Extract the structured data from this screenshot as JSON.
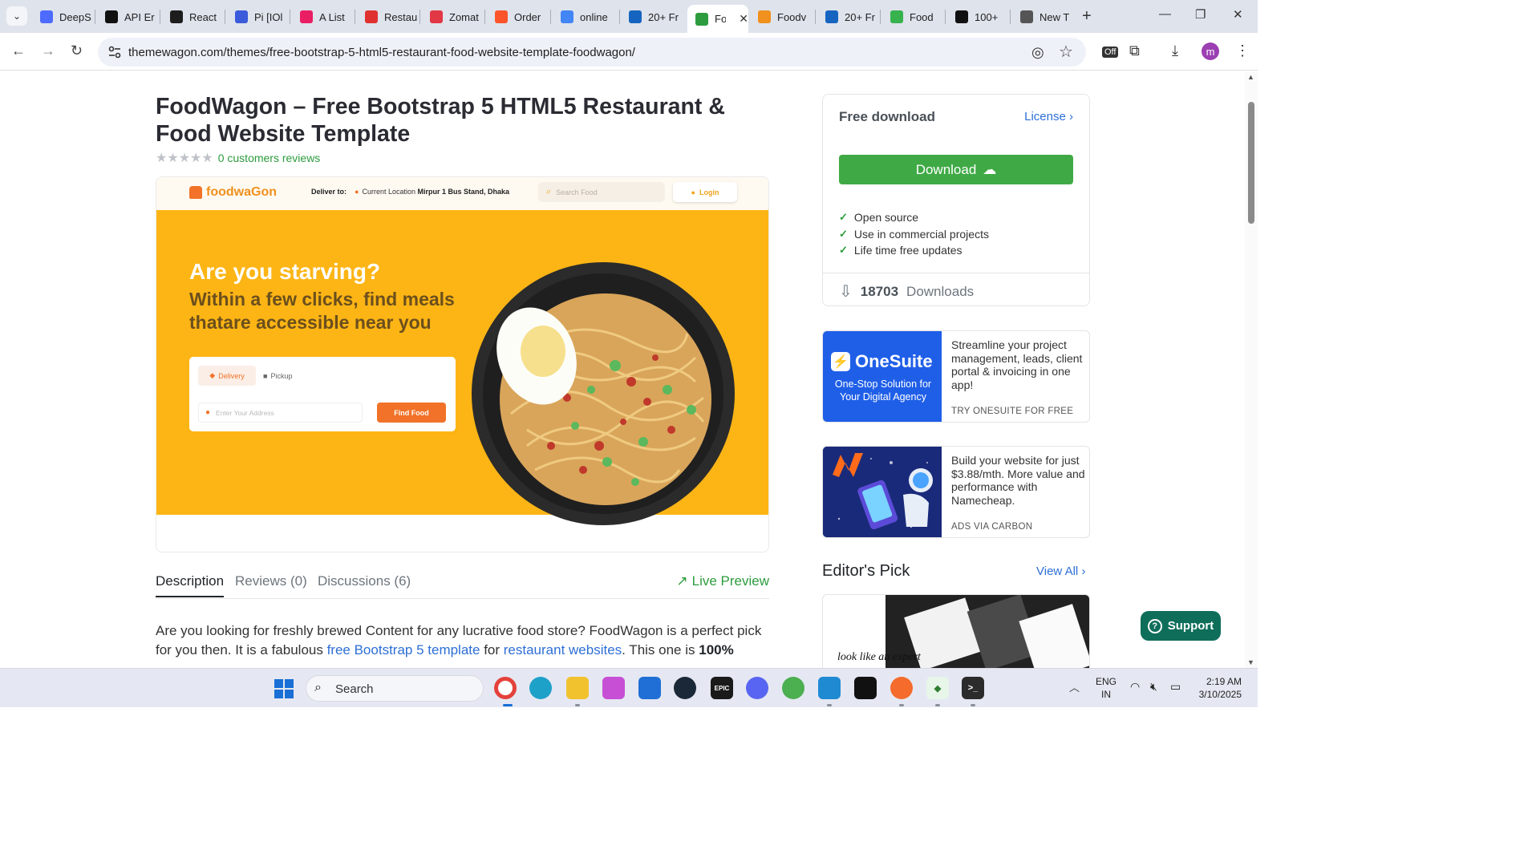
{
  "browser": {
    "tabs": [
      {
        "title": "DeepS",
        "icon": "deepseek-icon",
        "color": "#4d6bfe"
      },
      {
        "title": "API Er",
        "icon": "openai-icon",
        "color": "#111111"
      },
      {
        "title": "React",
        "icon": "react-icon",
        "color": "#1d1d1d"
      },
      {
        "title": "Pi [IOl",
        "icon": "pi-icon",
        "color": "#3b5bdb"
      },
      {
        "title": "A List",
        "icon": "list-icon",
        "color": "#e91e63"
      },
      {
        "title": "Restau",
        "icon": "restaurant-icon",
        "color": "#e03131"
      },
      {
        "title": "Zomat",
        "icon": "zomato-icon",
        "color": "#e23744"
      },
      {
        "title": "Order",
        "icon": "brave-icon",
        "color": "#fb542b"
      },
      {
        "title": "online",
        "icon": "google-icon",
        "color": "#4285f4"
      },
      {
        "title": "20+ Fr",
        "icon": "te-icon",
        "color": "#1565c0"
      },
      {
        "title": "Fo",
        "icon": "themewagon-icon",
        "color": "#2d9c3e",
        "active": true
      },
      {
        "title": "Foodv",
        "icon": "foodwagon-icon",
        "color": "#f0901d"
      },
      {
        "title": "20+ Fr",
        "icon": "te-icon",
        "color": "#1565c0"
      },
      {
        "title": "Food",
        "icon": "food-icon",
        "color": "#37b24d"
      },
      {
        "title": "100+",
        "icon": "unsplash-icon",
        "color": "#111111"
      },
      {
        "title": "New T",
        "icon": "chrome-icon",
        "color": "#555555"
      }
    ],
    "url": "themewagon.com/themes/free-bootstrap-5-html5-restaurant-food-website-template-foodwagon/"
  },
  "page": {
    "title": "FoodWagon – Free Bootstrap 5 HTML5 Restaurant & Food Website Template",
    "stars": "★★★★★",
    "reviews_link": "0 customers reviews",
    "preview": {
      "logo": "foodwaGon",
      "deliver_label": "Deliver to:",
      "location_label": "Current Location",
      "location_value": "Mirpur 1 Bus Stand, Dhaka",
      "search_placeholder": "Search Food",
      "login": "Login",
      "headline": "Are you starving?",
      "subheadline": "Within a few clicks, find meals thatare accessible near you",
      "tab_delivery": "Delivery",
      "tab_pickup": "Pickup",
      "address_placeholder": "Enter Your Address",
      "find_button": "Find Food"
    },
    "tabs": {
      "description": "Description",
      "reviews": "Reviews (0)",
      "discussions": "Discussions (6)",
      "live_preview": "Live Preview"
    },
    "description": {
      "line1": "Are you looking for freshly brewed Content for any lucrative food store? FoodWagon is a perfect pick for you then. It is a fabulous ",
      "link1": "free Bootstrap 5 template",
      "mid": " for ",
      "link2": "restaurant websites",
      "end": ". This one is ",
      "bold": "100%"
    }
  },
  "sidebar": {
    "download_card": {
      "heading": "Free download",
      "license": "License",
      "button": "Download",
      "features": [
        "Open source",
        "Use in commercial projects",
        "Life time free updates"
      ],
      "downloads_count": "18703",
      "downloads_label": "Downloads"
    },
    "ad_onesuite": {
      "logo": "OneSuite",
      "tagline": "One-Stop Solution for Your Digital Agency",
      "text": "Streamline your project management, leads, client portal & invoicing in one app!",
      "cta": "TRY ONESUITE FOR FREE"
    },
    "ad_namecheap": {
      "text": "Build your website for just $3.88/mth. More value and performance with Namecheap.",
      "cta": "ADS VIA CARBON"
    },
    "editors_pick": {
      "heading": "Editor's Pick",
      "view_all": "View All",
      "card_text": "look like an expert"
    }
  },
  "support_button": "Support",
  "taskbar": {
    "search": "Search",
    "lang_top": "ENG",
    "lang_bottom": "IN",
    "time": "2:19 AM",
    "date": "3/10/2025"
  }
}
